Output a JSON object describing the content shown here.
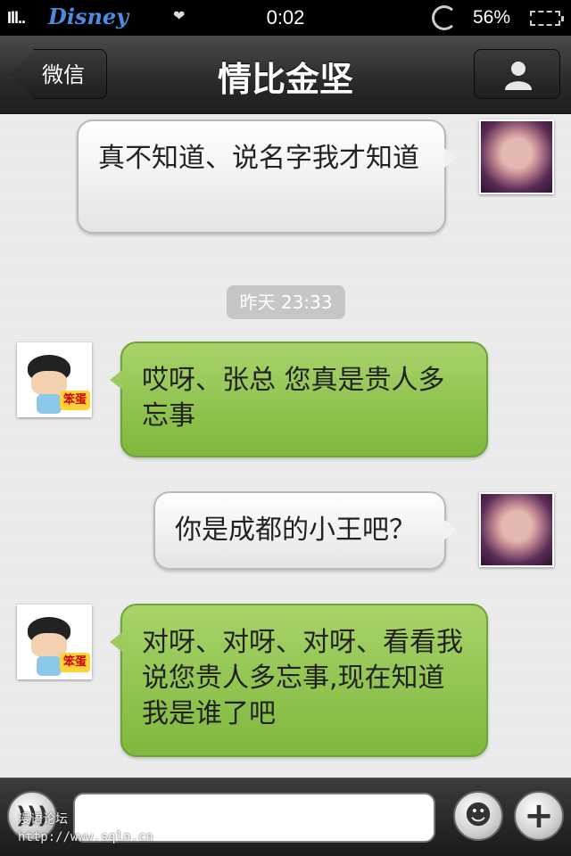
{
  "status_bar": {
    "signal": "Ill..",
    "carrier": "Disney",
    "time": "0:02",
    "battery_percent": "56%"
  },
  "nav": {
    "back_label": "微信",
    "title": "情比金坚",
    "profile_icon": "person-icon"
  },
  "messages": [
    {
      "sender": "me",
      "text": "真不知道、说名字我才知道"
    },
    {
      "sender": "other",
      "text": "哎呀、张总 您真是贵人多忘事"
    },
    {
      "sender": "me",
      "text": "你是成都的小王吧？"
    },
    {
      "sender": "other",
      "text": "对呀、对呀、对呀、看看我说您贵人多忘事,现在知道我是谁了吧"
    }
  ],
  "timestamp": "昨天 23:33",
  "avatar_tag": "笨蛋",
  "input_bar": {
    "text_value": "",
    "voice_icon": "voice-icon",
    "emoji_icon": "smiley-icon",
    "add_icon": "plus-icon"
  },
  "watermark": {
    "line1": "漫语论坛",
    "line2": "http://www.sqln.cn"
  },
  "colors": {
    "my_bubble": "#f2f2f2",
    "other_bubble": "#9cca5c",
    "nav_bar": "#2a2a2a"
  }
}
